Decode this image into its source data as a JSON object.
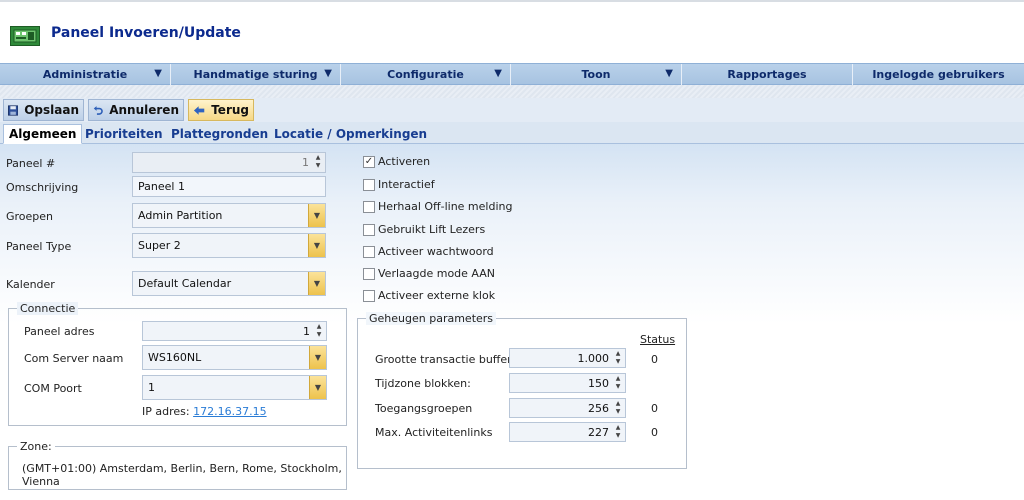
{
  "app": {
    "title": "Paneel Invoeren/Update",
    "icon": "panel-board-icon"
  },
  "nav": [
    {
      "label": "Administratie",
      "dropdown": true
    },
    {
      "label": "Handmatige sturing",
      "dropdown": true
    },
    {
      "label": "Configuratie",
      "dropdown": true
    },
    {
      "label": "Toon",
      "dropdown": true
    },
    {
      "label": "Rapportages",
      "dropdown": false
    },
    {
      "label": "Ingelogde gebruikers",
      "dropdown": false
    }
  ],
  "toolbar": {
    "save": "Opslaan",
    "cancel": "Annuleren",
    "back": "Terug"
  },
  "tabs": [
    "Algemeen",
    "Prioriteiten",
    "Plattegronden",
    "Locatie / Opmerkingen"
  ],
  "active_tab": "Algemeen",
  "form": {
    "panel_num_label": "Paneel #",
    "panel_num_value": "1",
    "description_label": "Omschrijving",
    "description_value": "Paneel 1",
    "groups_label": "Groepen",
    "groups_value": "Admin Partition",
    "panel_type_label": "Paneel Type",
    "panel_type_value": "Super 2",
    "calendar_label": "Kalender",
    "calendar_value": "Default Calendar"
  },
  "connection": {
    "legend": "Connectie",
    "address_label": "Paneel adres",
    "address_value": "1",
    "server_label": "Com Server naam",
    "server_value": "WS160NL",
    "port_label": "COM Poort",
    "port_value": "1",
    "ip_label": "IP adres:",
    "ip_value": "172.16.37.15"
  },
  "zone": {
    "legend": "Zone:",
    "value": "(GMT+01:00) Amsterdam, Berlin, Bern, Rome, Stockholm, Vienna"
  },
  "options": [
    {
      "label": "Activeren",
      "checked": true
    },
    {
      "label": "Interactief",
      "checked": false
    },
    {
      "label": "Herhaal Off-line melding",
      "checked": false
    },
    {
      "label": "Gebruikt Lift Lezers",
      "checked": false
    },
    {
      "label": "Activeer wachtwoord",
      "checked": false
    },
    {
      "label": "Verlaagde mode AAN",
      "checked": false
    },
    {
      "label": "Activeer externe klok",
      "checked": false
    }
  ],
  "memory": {
    "legend": "Geheugen parameters",
    "status_header": "Status",
    "rows": [
      {
        "label": "Grootte transactie buffer:",
        "value": "1.000",
        "status": "0"
      },
      {
        "label": "Tijdzone blokken:",
        "value": "150",
        "status": ""
      },
      {
        "label": "Toegangsgroepen",
        "value": "256",
        "status": "0"
      },
      {
        "label": "Max. Activiteitenlinks",
        "value": "227",
        "status": "0"
      }
    ]
  },
  "colors": {
    "nav_bg": "#b9d1ea",
    "title": "#0c2a8e",
    "dropdown_button": "#edc24c"
  }
}
